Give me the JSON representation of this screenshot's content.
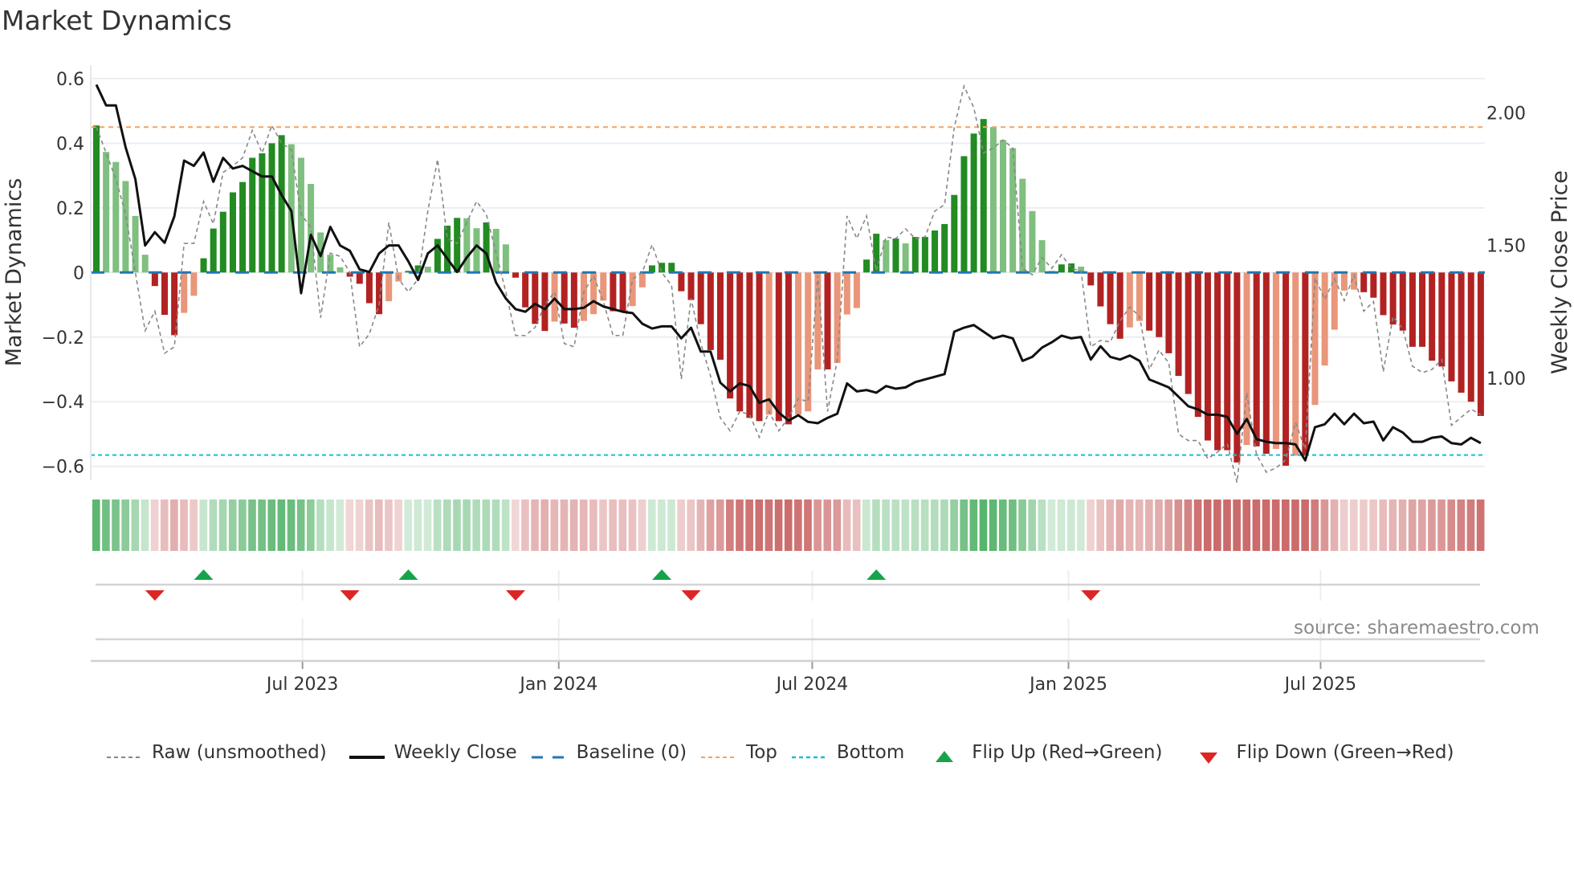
{
  "title": "Market Dynamics",
  "source": "source: sharemaestro.com",
  "legend": [
    {
      "label": "Raw (unsmoothed)",
      "kind": "raw"
    },
    {
      "label": "Weekly Close",
      "kind": "close"
    },
    {
      "label": "Baseline (0)",
      "kind": "baseline"
    },
    {
      "label": "Top",
      "kind": "top"
    },
    {
      "label": "Bottom",
      "kind": "bottom"
    },
    {
      "label": "Flip Up (Red→Green)",
      "kind": "flip-up"
    },
    {
      "label": "Flip Down (Green→Red)",
      "kind": "flip-down"
    }
  ],
  "colors": {
    "dark_green": "#228b22",
    "light_green": "#7fbf7f",
    "dark_red": "#b22222",
    "light_red": "#e9967a",
    "baseline": "#1f77b4",
    "top": "#f4a460",
    "bottom": "#17becf",
    "raw": "#888888",
    "close": "#111111",
    "flip_up": "#16a34a",
    "flip_down": "#dc2626"
  },
  "chart_data": {
    "type": "bar",
    "title": "Market Dynamics",
    "ylabel": "Market Dynamics",
    "y2label": "Weekly Close Price",
    "ylim": [
      -0.643,
      0.642
    ],
    "y2lim": [
      0.615,
      2.18
    ],
    "yticks": [
      0.6,
      0.4,
      0.2,
      0,
      -0.2,
      -0.4,
      -0.6
    ],
    "ytick_labels": [
      "0.6",
      "0.4",
      "0.2",
      "0",
      "−0.2",
      "−0.4",
      "−0.6"
    ],
    "y2ticks": [
      2.0,
      1.5,
      1.0
    ],
    "y2tick_labels": [
      "2.00",
      "1.50",
      "1.00"
    ],
    "xticks": [
      {
        "label": "Jul 2023",
        "date": "2023-07-01"
      },
      {
        "label": "Jan 2024",
        "date": "2024-01-01"
      },
      {
        "label": "Jul 2024",
        "date": "2024-07-01"
      },
      {
        "label": "Jan 2025",
        "date": "2025-01-01"
      },
      {
        "label": "Jul 2025",
        "date": "2025-07-01"
      }
    ],
    "start_date": "2023-02-03",
    "frequency": "weekly",
    "top": 0.45,
    "bottom": -0.565,
    "baseline": 0,
    "grid": true,
    "legend_position": "bottom",
    "smoothed": [
      0.455,
      0.373,
      0.342,
      0.283,
      0.175,
      0.055,
      -0.042,
      -0.131,
      -0.194,
      -0.125,
      -0.072,
      0.044,
      0.136,
      0.188,
      0.248,
      0.28,
      0.355,
      0.369,
      0.4,
      0.425,
      0.397,
      0.355,
      0.274,
      0.124,
      0.055,
      0.016,
      -0.013,
      -0.035,
      -0.095,
      -0.129,
      -0.089,
      -0.028,
      0.005,
      0.022,
      0.018,
      0.104,
      0.145,
      0.169,
      0.168,
      0.137,
      0.155,
      0.135,
      0.087,
      -0.016,
      -0.108,
      -0.159,
      -0.181,
      -0.152,
      -0.158,
      -0.171,
      -0.15,
      -0.129,
      -0.087,
      -0.12,
      -0.122,
      -0.104,
      -0.046,
      0.022,
      0.03,
      0.03,
      -0.058,
      -0.085,
      -0.16,
      -0.24,
      -0.27,
      -0.39,
      -0.43,
      -0.45,
      -0.46,
      -0.44,
      -0.46,
      -0.47,
      -0.44,
      -0.43,
      -0.3,
      -0.3,
      -0.28,
      -0.13,
      -0.11,
      0.04,
      0.12,
      0.1,
      0.105,
      0.09,
      0.11,
      0.11,
      0.13,
      0.15,
      0.24,
      0.36,
      0.43,
      0.475,
      0.45,
      0.41,
      0.385,
      0.29,
      0.19,
      0.1,
      0.005,
      0.025,
      0.028,
      0.018,
      -0.04,
      -0.105,
      -0.16,
      -0.205,
      -0.17,
      -0.15,
      -0.18,
      -0.2,
      -0.25,
      -0.32,
      -0.376,
      -0.447,
      -0.52,
      -0.55,
      -0.55,
      -0.588,
      -0.534,
      -0.538,
      -0.561,
      -0.546,
      -0.598,
      -0.567,
      -0.567,
      -0.41,
      -0.288,
      -0.177,
      -0.056,
      -0.053,
      -0.061,
      -0.078,
      -0.132,
      -0.161,
      -0.18,
      -0.23,
      -0.23,
      -0.273,
      -0.291,
      -0.337,
      -0.372,
      -0.4,
      -0.444
    ],
    "raw": [
      0.45,
      0.37,
      0.29,
      0.18,
      0.0,
      -0.18,
      -0.12,
      -0.25,
      -0.23,
      0.09,
      0.09,
      0.22,
      0.15,
      0.31,
      0.33,
      0.355,
      0.44,
      0.37,
      0.455,
      0.4,
      0.38,
      0.18,
      0.14,
      -0.14,
      0.06,
      0.05,
      0,
      -0.23,
      -0.19,
      -0.1,
      0.155,
      -0.02,
      -0.06,
      -0.02,
      0.19,
      0.35,
      0.105,
      0.09,
      0.155,
      0.22,
      0.18,
      0.06,
      -0.06,
      -0.195,
      -0.195,
      -0.17,
      -0.1,
      -0.06,
      -0.22,
      -0.23,
      -0.06,
      -0.01,
      -0.09,
      -0.195,
      -0.195,
      -0.02,
      0.0,
      0.086,
      0,
      -0.04,
      -0.33,
      -0.08,
      -0.22,
      -0.32,
      -0.45,
      -0.49,
      -0.43,
      -0.44,
      -0.51,
      -0.43,
      -0.49,
      -0.45,
      -0.39,
      -0.4,
      -0.01,
      -0.43,
      -0.27,
      0.175,
      0.105,
      0.175,
      0.005,
      0.11,
      0.105,
      0.135,
      0.105,
      0.11,
      0.19,
      0.21,
      0.45,
      0.577,
      0.51,
      0.37,
      0.385,
      0.41,
      0.385,
      0.013,
      -0.007,
      0.046,
      0.013,
      0.055,
      0.013,
      0.005,
      -0.23,
      -0.21,
      -0.215,
      -0.15,
      -0.107,
      -0.136,
      -0.3,
      -0.24,
      -0.28,
      -0.5,
      -0.52,
      -0.52,
      -0.576,
      -0.556,
      -0.53,
      -0.65,
      -0.373,
      -0.564,
      -0.618,
      -0.605,
      -0.58,
      -0.464,
      -0.547,
      -0.017,
      -0.083,
      -0.02,
      -0.087,
      -0.008,
      -0.12,
      -0.09,
      -0.307,
      -0.137,
      -0.174,
      -0.29,
      -0.31,
      -0.3,
      -0.27,
      -0.473,
      -0.448,
      -0.423,
      -0.44
    ],
    "close": [
      2.106,
      2.028,
      2.028,
      1.87,
      1.75,
      1.5,
      1.55,
      1.51,
      1.61,
      1.82,
      1.8,
      1.85,
      1.74,
      1.83,
      1.79,
      1.8,
      1.78,
      1.76,
      1.76,
      1.69,
      1.63,
      1.32,
      1.54,
      1.46,
      1.57,
      1.5,
      1.48,
      1.41,
      1.4,
      1.47,
      1.5,
      1.5,
      1.44,
      1.37,
      1.47,
      1.5,
      1.45,
      1.4,
      1.455,
      1.5,
      1.47,
      1.36,
      1.3,
      1.26,
      1.25,
      1.28,
      1.26,
      1.3,
      1.26,
      1.26,
      1.265,
      1.29,
      1.27,
      1.26,
      1.25,
      1.245,
      1.205,
      1.187,
      1.195,
      1.195,
      1.15,
      1.19,
      1.1,
      1.1,
      0.983,
      0.95,
      0.98,
      0.97,
      0.907,
      0.92,
      0.87,
      0.84,
      0.86,
      0.835,
      0.83,
      0.85,
      0.866,
      0.98,
      0.95,
      0.955,
      0.945,
      0.97,
      0.96,
      0.965,
      0.985,
      0.995,
      1.005,
      1.015,
      1.175,
      1.19,
      1.2,
      1.175,
      1.15,
      1.16,
      1.15,
      1.065,
      1.08,
      1.115,
      1.135,
      1.16,
      1.15,
      1.155,
      1.07,
      1.12,
      1.08,
      1.07,
      1.085,
      1.065,
      0.995,
      0.98,
      0.965,
      0.93,
      0.894,
      0.882,
      0.862,
      0.862,
      0.854,
      0.79,
      0.846,
      0.77,
      0.76,
      0.755,
      0.755,
      0.75,
      0.69,
      0.815,
      0.826,
      0.866,
      0.826,
      0.866,
      0.83,
      0.836,
      0.765,
      0.815,
      0.795,
      0.76,
      0.76,
      0.775,
      0.78,
      0.755,
      0.75,
      0.775,
      0.755
    ],
    "flips_up": [
      "2023-04-21",
      "2023-09-15",
      "2024-03-15",
      "2024-08-16"
    ],
    "flips_down": [
      "2023-03-17",
      "2023-08-04",
      "2023-12-01",
      "2024-04-05",
      "2025-01-17"
    ]
  }
}
